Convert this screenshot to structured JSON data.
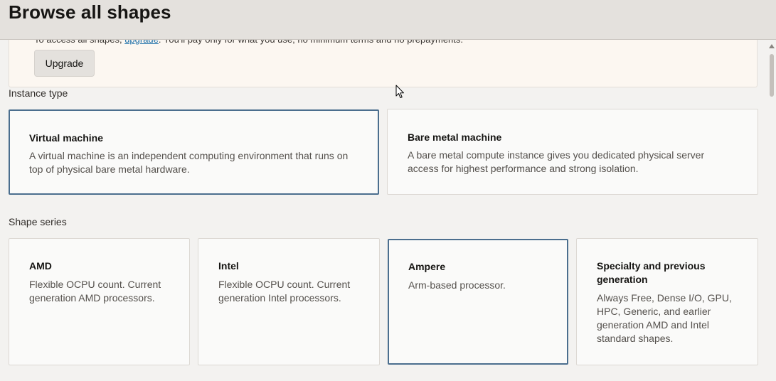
{
  "header": {
    "title": "Browse all shapes"
  },
  "banner": {
    "text_prefix": "To access all shapes, ",
    "link_text": "upgrade",
    "text_suffix": ". You'll pay only for what you use, no minimum terms and no prepayments.",
    "button_label": "Upgrade"
  },
  "instance_type": {
    "label": "Instance type",
    "options": [
      {
        "title": "Virtual machine",
        "description": "A virtual machine is an independent computing environment that runs on top of physical bare metal hardware.",
        "selected": true
      },
      {
        "title": "Bare metal machine",
        "description": "A bare metal compute instance gives you dedicated physical server access for highest performance and strong isolation.",
        "selected": false
      }
    ]
  },
  "shape_series": {
    "label": "Shape series",
    "options": [
      {
        "title": "AMD",
        "description": "Flexible OCPU count. Current generation AMD processors.",
        "selected": false
      },
      {
        "title": "Intel",
        "description": "Flexible OCPU count. Current generation Intel processors.",
        "selected": false
      },
      {
        "title": "Ampere",
        "description": "Arm-based processor.",
        "selected": true
      },
      {
        "title": "Specialty and previous generation",
        "description": "Always Free, Dense I/O, GPU, HPC, Generic, and earlier generation AMD and Intel standard shapes.",
        "selected": false
      }
    ]
  },
  "colors": {
    "selected_border": "#4b6e8e",
    "banner_background": "#fcf7f1",
    "link": "#1b6ea8"
  },
  "icons": [
    "mouse-cursor-icon",
    "scroll-up-arrow-icon"
  ]
}
